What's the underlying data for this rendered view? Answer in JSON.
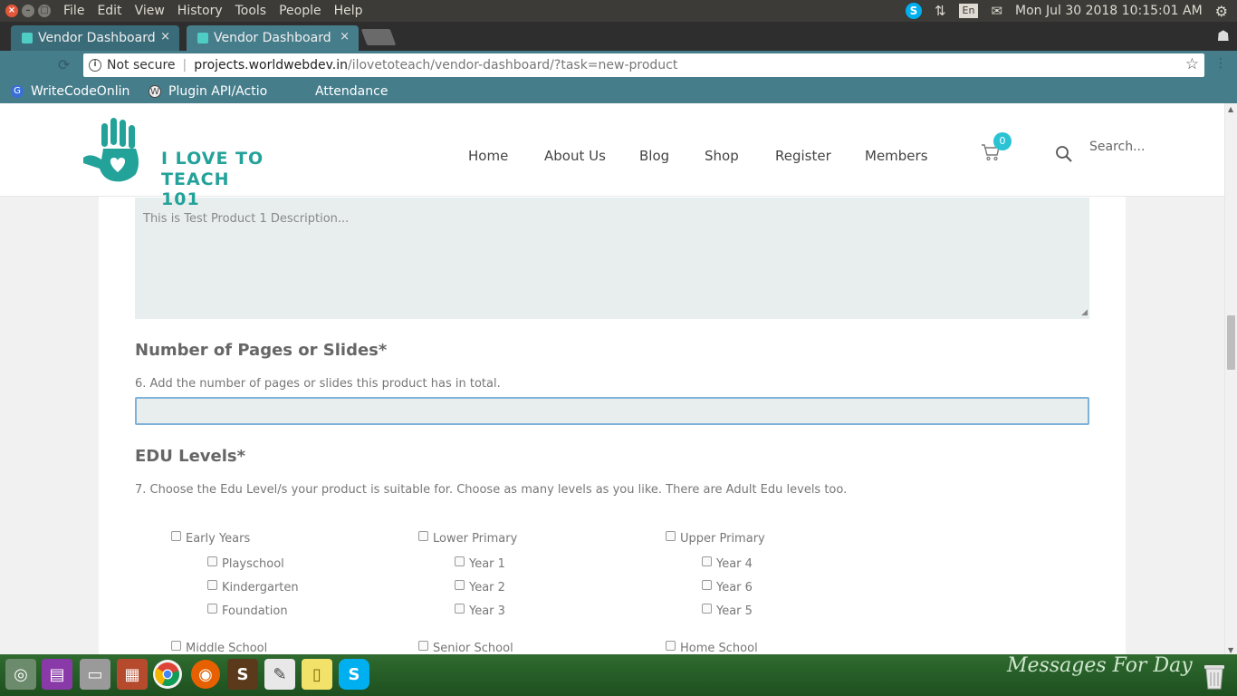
{
  "os": {
    "menu": [
      "File",
      "Edit",
      "View",
      "History",
      "Tools",
      "People",
      "Help"
    ],
    "lang": "En",
    "clock": "Mon Jul 30 2018 10:15:01 AM",
    "skype_letter": "S"
  },
  "browser": {
    "tabs": [
      {
        "title": "Vendor Dashboard"
      },
      {
        "title": "Vendor Dashboard"
      }
    ],
    "close_glyph": "×",
    "security_label": "Not secure",
    "url_host": "projects.worldwebdev.in",
    "url_path": "/ilovetoteach/vendor-dashboard/?task=new-product",
    "bookmarks": [
      "WriteCodeOnlin",
      "Plugin API/Actio",
      "Attendance"
    ]
  },
  "site": {
    "logo_line1": "I LOVE TO",
    "logo_line2": "TEACH 101",
    "nav": [
      "Home",
      "About Us",
      "Blog",
      "Shop",
      "Register",
      "Members"
    ],
    "cart_count": "0",
    "search_placeholder": "Search..."
  },
  "form": {
    "description_value": "This is Test Product 1 Description...",
    "pages": {
      "title": "Number of Pages or Slides*",
      "help": "6. Add the number of pages or slides this product has in total.",
      "value": ""
    },
    "edu": {
      "title": "EDU Levels*",
      "help": "7. Choose the Edu Level/s your product is suitable for. Choose as many levels as you like. There are Adult Edu levels too.",
      "groups": [
        {
          "label": "Early Years",
          "children": [
            "Playschool",
            "Kindergarten",
            "Foundation"
          ]
        },
        {
          "label": "Lower Primary",
          "children": [
            "Year 1",
            "Year 2",
            "Year 3"
          ]
        },
        {
          "label": "Upper Primary",
          "children": [
            "Year 4",
            "Year 6",
            "Year 5"
          ]
        }
      ],
      "next_row": [
        "Middle School",
        "Senior School",
        "Home School"
      ]
    }
  },
  "desktop": {
    "wallpaper_text": "Messages For Day"
  }
}
